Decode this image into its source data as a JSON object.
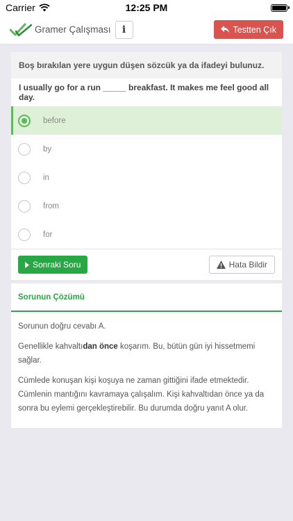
{
  "status_bar": {
    "carrier": "Carrier",
    "time": "12:25 PM"
  },
  "header": {
    "title": "Gramer Çalışması",
    "info_label": "i",
    "exit_label": "Testten Çık",
    "exit_color": "#d9534f"
  },
  "question": {
    "instruction": "Boş bırakılan yere uygun düşen sözcük ya da ifadeyi bulunuz.",
    "text": "I usually go for a run _____ breakfast. It makes me feel good all day.",
    "selected_index": 0,
    "options": [
      {
        "label": "before"
      },
      {
        "label": "by"
      },
      {
        "label": "in"
      },
      {
        "label": "from"
      },
      {
        "label": "for"
      }
    ]
  },
  "actions": {
    "next_label": "Sonraki Soru",
    "report_label": "Hata Bildir"
  },
  "solution": {
    "title": "Sorunun Çözümü",
    "answer_line": "Sorunun doğru cevabı A.",
    "translation_pre": "Genellikle kahvaltı",
    "translation_bold": "dan önce",
    "translation_post": " koşarım. Bu, bütün gün iyi hissetmemi sağlar.",
    "explanation": "Cümlede konuşan kişi koşuya ne zaman gittiğini ifade etmektedir. Cümlenin mantığını kavramaya çalışalım. Kişi kahvaltıdan önce ya da sonra bu eylemi gerçekleştirebilir. Bu durumda doğru yanıt A olur."
  },
  "colors": {
    "accent_green": "#28a745",
    "selected_bg": "#dff0d8",
    "danger": "#d9534f"
  }
}
